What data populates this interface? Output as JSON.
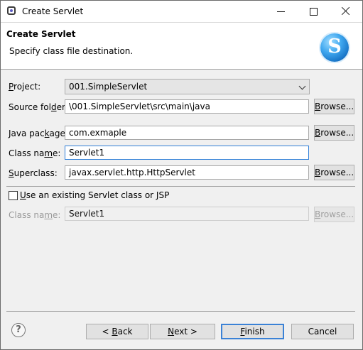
{
  "window": {
    "title": "Create Servlet",
    "icons": {
      "app": "eclipse-app-icon",
      "minimize": "minimize-icon",
      "maximize": "maximize-icon",
      "close": "close-icon"
    }
  },
  "banner": {
    "title": "Create Servlet",
    "description": "Specify class file destination.",
    "logo_icon": "servlet-s-logo-icon",
    "logo_letter": "S"
  },
  "form": {
    "project": {
      "label_ul": "P",
      "label_rest": "roject:",
      "value": "001.SimpleServlet"
    },
    "source_folder": {
      "label_pre": "Source fol",
      "label_ul": "d",
      "label_post": "er:",
      "value": "\\001.SimpleServlet\\src\\main\\java",
      "browse": "Browse..."
    },
    "java_package": {
      "label_pre": "Java pac",
      "label_ul": "k",
      "label_post": "age:",
      "value": "com.exmaple",
      "browse": "Browse..."
    },
    "class_name": {
      "label_pre": "Class na",
      "label_ul": "m",
      "label_post": "e:",
      "value": "Servlet1"
    },
    "superclass": {
      "label_ul": "S",
      "label_rest": "uperclass:",
      "value": "javax.servlet.http.HttpServlet",
      "browse": "Browse..."
    },
    "existing": {
      "checkbox_ul": "U",
      "checkbox_rest": "se an existing Servlet class or JSP",
      "checked": false,
      "class_label_pre": "Class na",
      "class_label_ul": "m",
      "class_label_post": "e:",
      "class_value": "Servlet1",
      "browse": "Browse..."
    }
  },
  "footer": {
    "help_icon": "help-question-icon",
    "help_glyph": "?",
    "back": {
      "pre": "< ",
      "ul": "B",
      "post": "ack"
    },
    "next": {
      "ul": "N",
      "post": "ext >"
    },
    "finish": {
      "ul": "F",
      "post": "inish"
    },
    "cancel": "Cancel"
  },
  "colors": {
    "dialog_bg": "#f0f0f0",
    "focus_border": "#2f7fd8",
    "primary_border": "#3b82d6"
  }
}
